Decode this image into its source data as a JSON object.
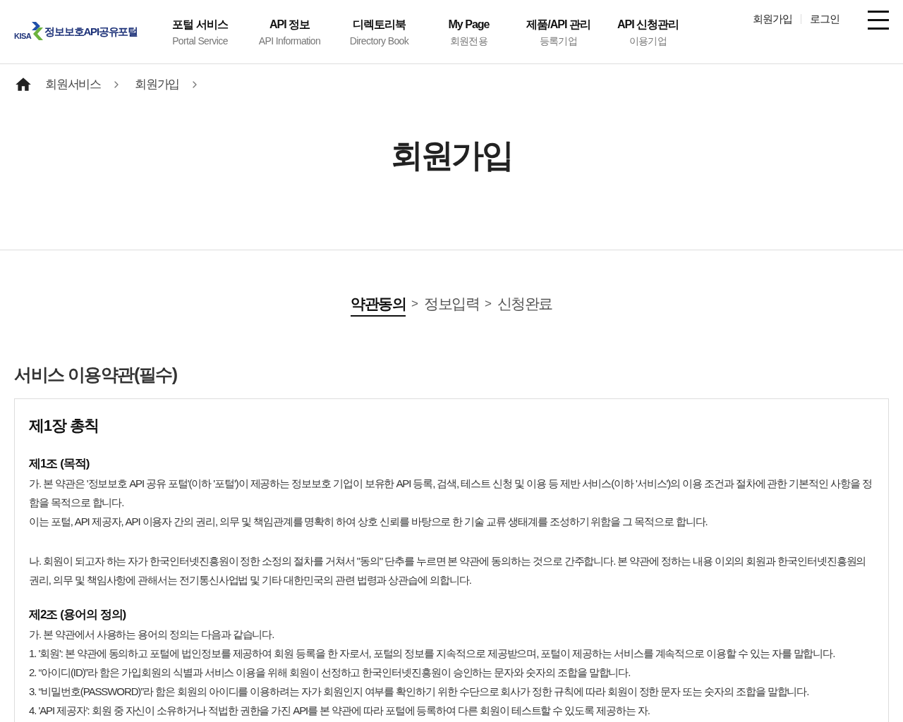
{
  "header": {
    "logo": {
      "mark": "KISA",
      "name": "정보보호API공유포털"
    },
    "nav": [
      {
        "title": "포털 서비스",
        "subtitle": "Portal Service"
      },
      {
        "title": "API 정보",
        "subtitle": "API Information"
      },
      {
        "title": "디렉토리북",
        "subtitle": "Directory Book"
      },
      {
        "title": "My Page",
        "subtitle": "회원전용"
      },
      {
        "title": "제품/API 관리",
        "subtitle": "등록기업"
      },
      {
        "title": "API 신청관리",
        "subtitle": "이용기업"
      }
    ],
    "account_links": [
      "회원가입",
      "로그인"
    ]
  },
  "breadcrumb": [
    "회원서비스",
    "회원가입"
  ],
  "page_title": "회원가입",
  "steps": [
    {
      "label": "약관동의",
      "selected": true
    },
    {
      "separator": ">",
      "label": "정보입력",
      "selected": false
    },
    {
      "separator": ">",
      "label": "신청완료",
      "selected": false
    }
  ],
  "terms": {
    "title": "서비스 이용약관(필수)",
    "chapter": "제1장 총칙",
    "articles": [
      {
        "heading": "제1조 (목적)",
        "blocks": [
          [
            "가. 본 약관은 '정보보호 API 공유 포털'(이하 '포털')이 제공하는 정보보호 기업이 보유한 API 등록, 검색, 테스트 신청 및 이용 등 제반 서비스(이하 '서비스')의 이용 조건과 절차에 관한 기본적인 사항을 정함을 목적으로 합니다.",
            "이는 포털, API 제공자, API 이용자 간의 권리, 의무 및 책임관계를 명확히 하여 상호 신뢰를 바탕으로 한 기술 교류 생태계를 조성하기 위함을 그 목적으로 합니다."
          ],
          [
            "나. 회원이 되고자 하는 자가 한국인터넷진흥원이 정한 소정의 절차를 거쳐서 \"동의\" 단추를 누르면 본 약관에 동의하는 것으로 간주합니다. 본 약관에 정하는 내용 이외의 회원과 한국인터넷진흥원의 권리, 의무 및 책임사항에 관해서는 전기통신사업법 및 기타 대한민국의 관련 법령과 상관습에 의합니다."
          ]
        ]
      },
      {
        "heading": "제2조 (용어의 정의)",
        "blocks": [
          [
            "가. 본 약관에서 사용하는 용어의 정의는 다음과 같습니다.",
            "1. '회원': 본 약관에 동의하고 포털에 법인정보를 제공하여 회원 등록을 한 자로서, 포털의 정보를 지속적으로 제공받으며, 포털이 제공하는 서비스를 계속적으로 이용할 수 있는 자를 말합니다.",
            "2. “아이디(ID)”라 함은 가입회원의 식별과 서비스 이용을 위해 회원이 선정하고 한국인터넷진흥원이 승인하는 문자와 숫자의 조합을 말합니다.",
            "3. “비밀번호(PASSWORD)”라 함은 회원의 아이디를 이용하려는 자가 회원인지 여부를 확인하기 위한 수단으로 회사가 정한 규칙에 따라 회원이 정한 문자 또는 숫자의 조합을 말합니다.",
            "4. 'API 제공자': 회원 중 자신이 소유하거나 적법한 권한을 가진 API를 본 약관에 따라 포털에 등록하여 다른 회원이 테스트할 수 있도록 제공하는 자."
          ]
        ]
      }
    ]
  }
}
